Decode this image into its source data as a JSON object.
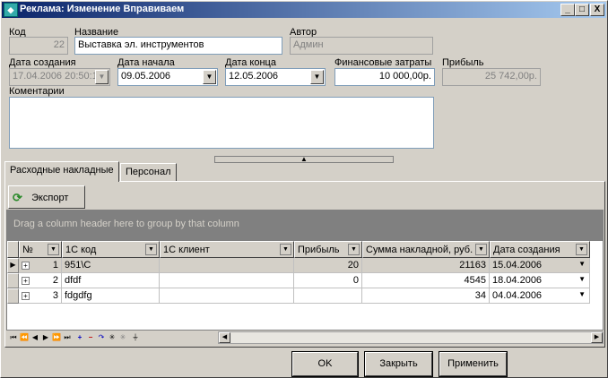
{
  "window": {
    "title": "Реклама: Изменение Вправиваем",
    "min": "_",
    "max": "□",
    "close": "X"
  },
  "form": {
    "kod_label": "Код",
    "kod_value": "22",
    "nazvanie_label": "Название",
    "nazvanie_value": "Выставка эл. инструментов",
    "avtor_label": "Автор",
    "avtor_value": "Админ",
    "data_sozdaniya_label": "Дата создания",
    "data_sozdaniya_value": "17.04.2006 20:50:1",
    "data_nachala_label": "Дата начала",
    "data_nachala_value": "09.05.2006",
    "data_konca_label": "Дата конца",
    "data_konca_value": "12.05.2006",
    "fin_label": "Финансовые затраты",
    "fin_value": "10 000,00р.",
    "pribyl_label": "Прибыль",
    "pribyl_value": "25 742,00р.",
    "comment_label": "Коментарии",
    "comment_value": ""
  },
  "tabs": [
    {
      "label": "Расходные накладные"
    },
    {
      "label": "Персонал"
    }
  ],
  "toolbar": {
    "export_label": "Экспорт"
  },
  "grid": {
    "group_hint": "Drag a column header here to group by that column",
    "columns": [
      "№",
      "1С код",
      "1С клиент",
      "Прибыль",
      "Сумма накладной, руб.",
      "Дата создания"
    ],
    "rows": [
      {
        "n": "1",
        "kod": "951\\C",
        "client": "",
        "pribyl": "20",
        "summa": "21163",
        "date": "15.04.2006"
      },
      {
        "n": "2",
        "kod": "dfdf",
        "client": "",
        "pribyl": "0",
        "summa": "4545",
        "date": "18.04.2006"
      },
      {
        "n": "3",
        "kod": "fdgdfg",
        "client": "",
        "pribyl": "",
        "summa": "34",
        "date": "04.04.2006"
      }
    ]
  },
  "buttons": {
    "ok": "OK",
    "close": "Закрыть",
    "apply": "Применить"
  }
}
